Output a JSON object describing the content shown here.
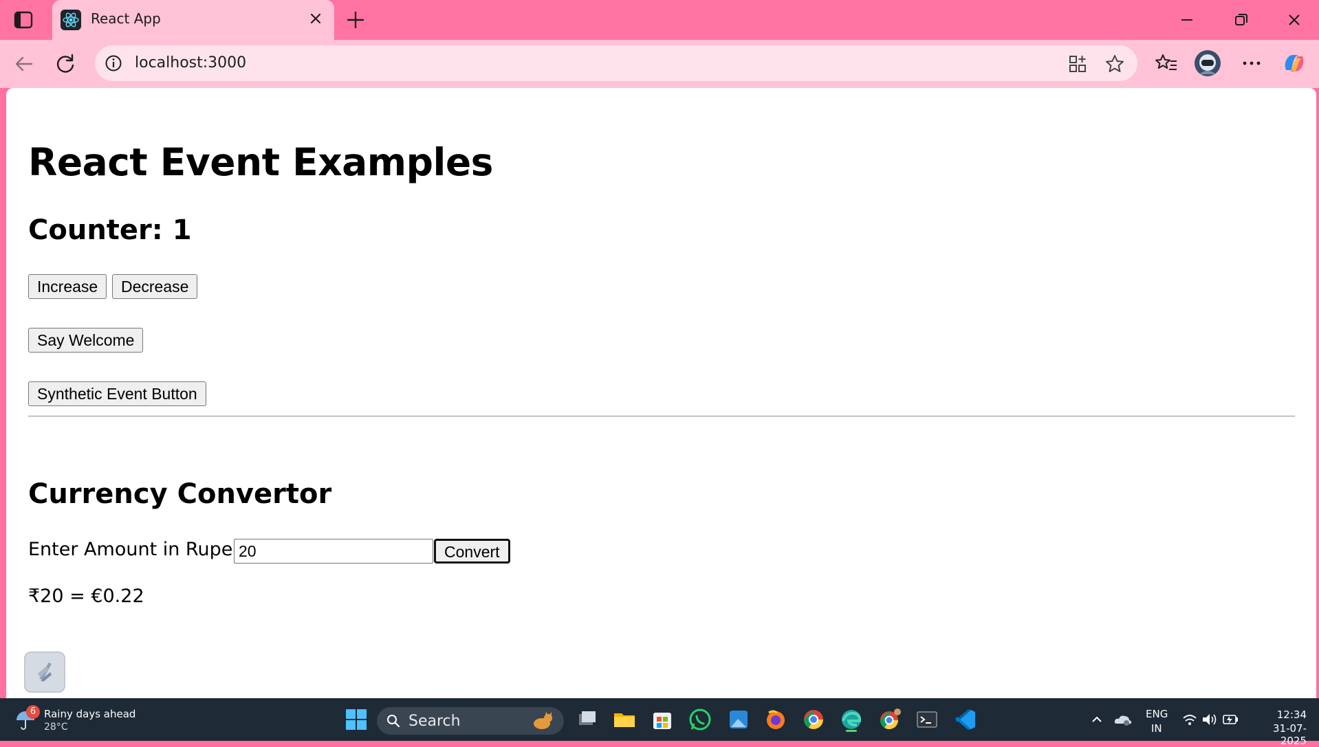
{
  "browser": {
    "tab_title": "React App",
    "url": "localhost:3000"
  },
  "page": {
    "title": "React Event Examples",
    "counter_text": "Counter: 1",
    "increase_label": "Increase",
    "decrease_label": "Decrease",
    "welcome_label": "Say Welcome",
    "synthetic_label": "Synthetic Event Button",
    "currency_title": "Currency Convertor",
    "amount_label": "Enter Amount in Rupees:",
    "amount_value": "20",
    "convert_label": "Convert",
    "result_text": "₹20 = €0.22"
  },
  "taskbar": {
    "weather_badge": "6",
    "weather_text": "Rainy days ahead",
    "weather_temp": "28°C",
    "search_label": "Search",
    "lang_primary": "ENG",
    "lang_secondary": "IN",
    "time": "12:34",
    "date": "31-07-2025"
  },
  "colors": {
    "tabbar": "#ff74a2",
    "toolbar": "#ffc2d6",
    "taskbar": "#1e2a36"
  }
}
